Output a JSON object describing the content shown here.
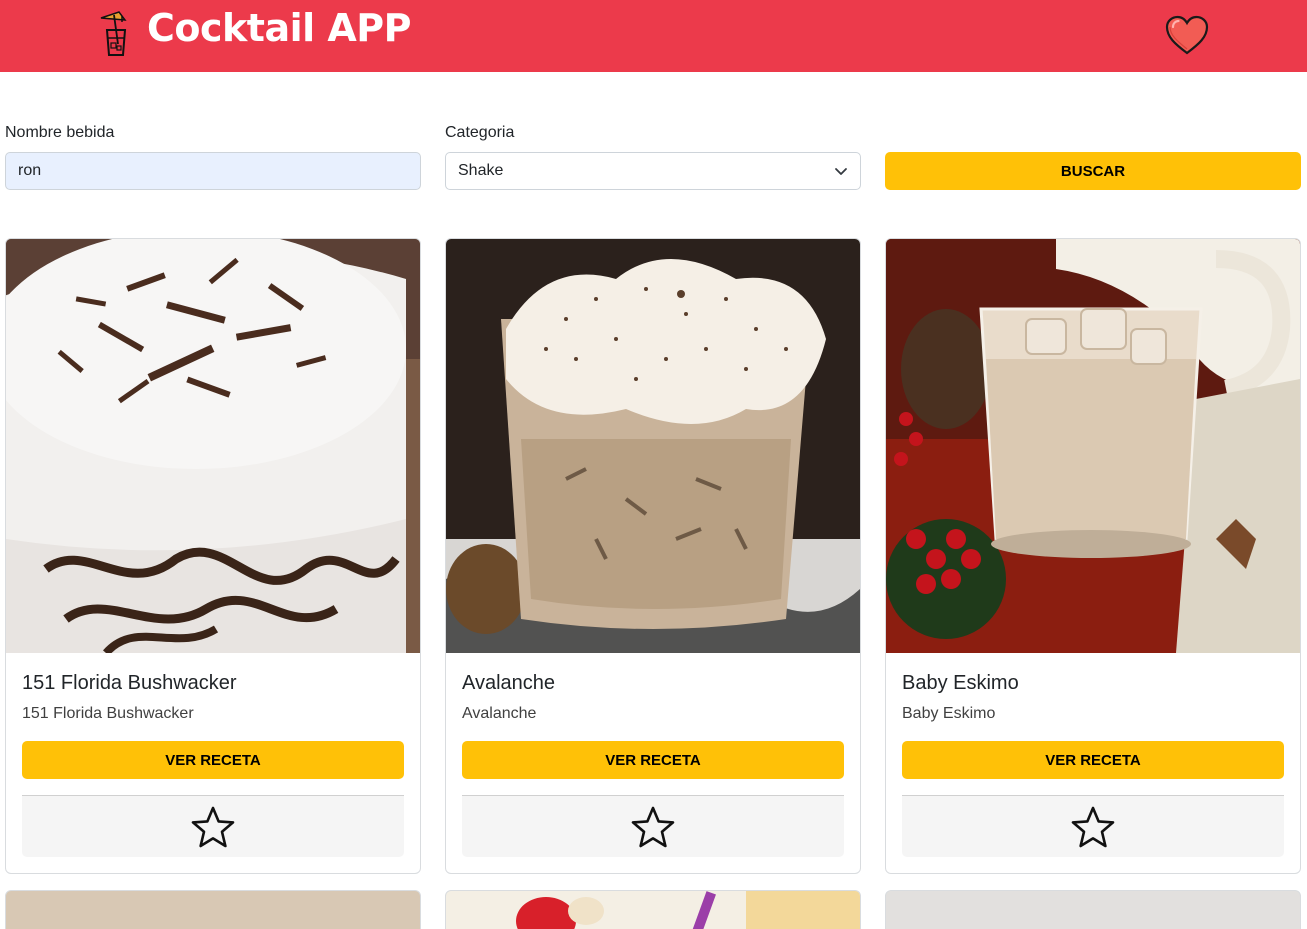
{
  "header": {
    "title": "Cocktail APP",
    "brand_color": "#ec3a4b",
    "logo_icon": "cocktail-glass-icon",
    "favorites_icon": "heart-icon"
  },
  "form": {
    "name_label": "Nombre bebida",
    "name_value": "ron",
    "category_label": "Categoria",
    "category_value": "Shake",
    "search_button": "BUSCAR",
    "accent_color": "#ffc107"
  },
  "cards": [
    {
      "title": "151 Florida Bushwacker",
      "subtitle": "151 Florida Bushwacker",
      "button": "VER RECETA",
      "favorite_icon": "star-outline-icon"
    },
    {
      "title": "Avalanche",
      "subtitle": "Avalanche",
      "button": "VER RECETA",
      "favorite_icon": "star-outline-icon"
    },
    {
      "title": "Baby Eskimo",
      "subtitle": "Baby Eskimo",
      "button": "VER RECETA",
      "favorite_icon": "star-outline-icon"
    }
  ]
}
